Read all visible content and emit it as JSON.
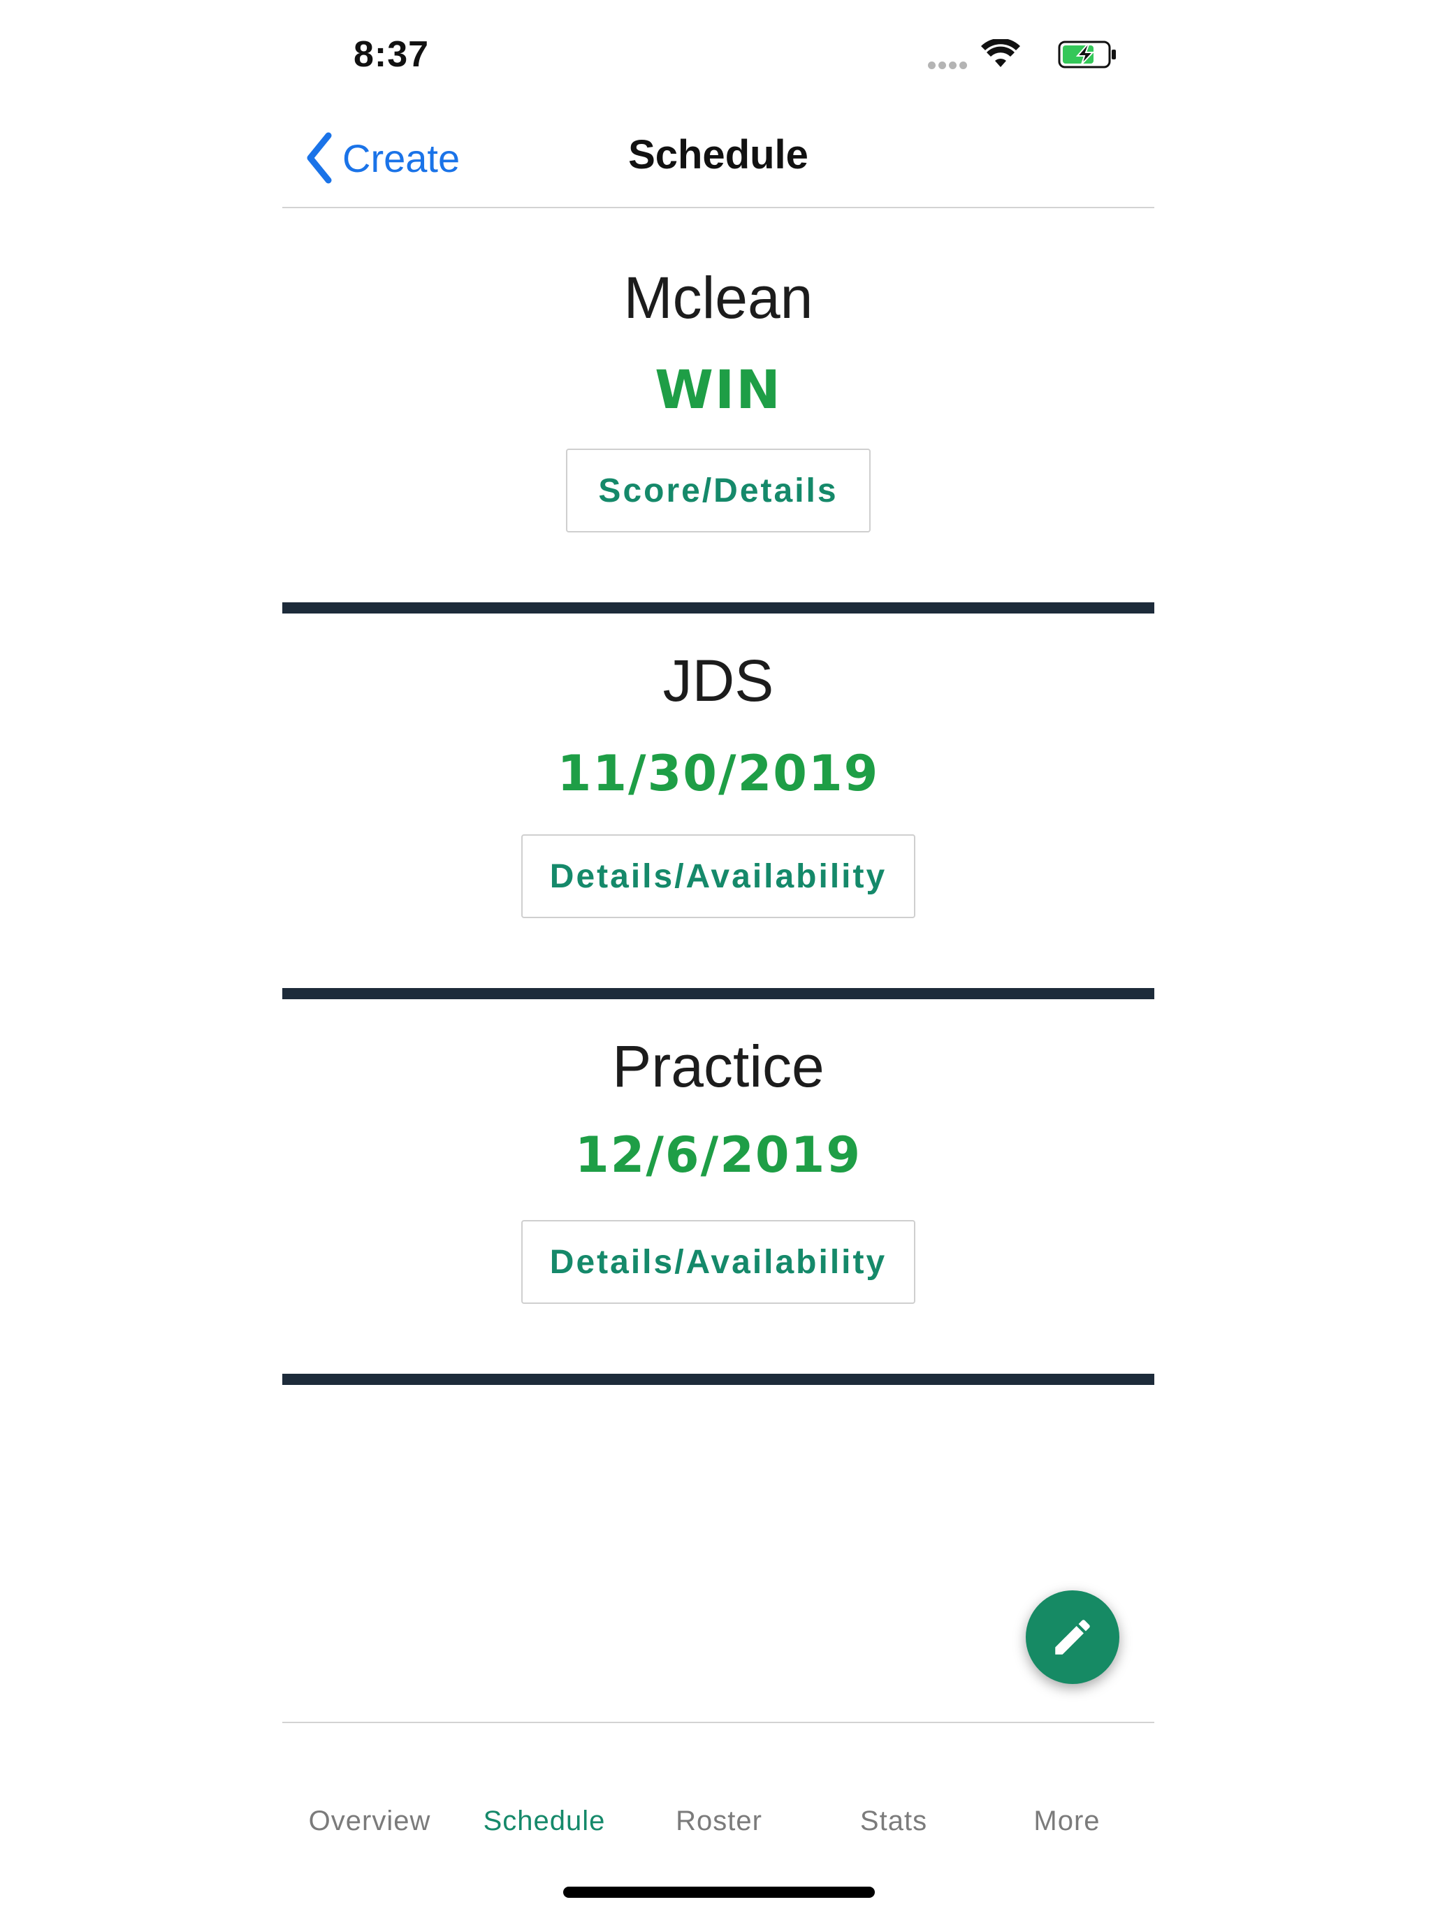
{
  "status_bar": {
    "time": "8:37"
  },
  "nav": {
    "back_label": "Create",
    "title": "Schedule"
  },
  "events": [
    {
      "name": "Mclean",
      "status": "WIN",
      "button": "Score/Details"
    },
    {
      "name": "JDS",
      "status": "11/30/2019",
      "button": "Details/Availability"
    },
    {
      "name": "Practice",
      "status": "12/6/2019",
      "button": "Details/Availability"
    }
  ],
  "tabs": [
    {
      "label": "Overview",
      "active": false
    },
    {
      "label": "Schedule",
      "active": true
    },
    {
      "label": "Roster",
      "active": false
    },
    {
      "label": "Stats",
      "active": false
    },
    {
      "label": "More",
      "active": false
    }
  ],
  "colors": {
    "accent": "#15896a",
    "status_green": "#1e9e46",
    "link_blue": "#1a73e8",
    "divider": "#1d2b3a",
    "fab": "#168a64"
  },
  "icons": {
    "back": "chevron-left-icon",
    "fab": "pencil-icon",
    "wifi": "wifi-icon",
    "battery": "battery-charging-icon"
  }
}
